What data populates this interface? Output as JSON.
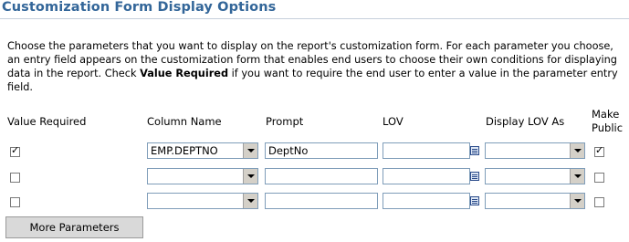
{
  "section": {
    "title": "Customization Form Display Options"
  },
  "description": {
    "part1": "Choose the parameters that you want to display on the report's customization form. For each parameter you choose, an entry field appears on the customization form that enables end users to choose their own conditions for displaying data in the report. Check ",
    "bold": "Value Required",
    "part2": " if you want to require the end user to enter a value in the parameter entry field."
  },
  "headers": {
    "value_required": "Value Required",
    "column_name": "Column Name",
    "prompt": "Prompt",
    "lov": "LOV",
    "display_lov_as": "Display LOV As",
    "make_public_line1": "Make",
    "make_public_line2": "Public"
  },
  "rows": [
    {
      "value_required": true,
      "column_name": "EMP.DEPTNO",
      "prompt": "DeptNo",
      "lov": "",
      "display_lov_as": "",
      "make_public": true
    },
    {
      "value_required": false,
      "column_name": "",
      "prompt": "",
      "lov": "",
      "display_lov_as": "",
      "make_public": false
    },
    {
      "value_required": false,
      "column_name": "",
      "prompt": "",
      "lov": "",
      "display_lov_as": "",
      "make_public": false
    }
  ],
  "buttons": {
    "more_parameters": "More Parameters"
  },
  "icons": {
    "lov_icon": "list-icon",
    "dropdown_icon": "chevron-down-icon",
    "checkbox_icon": "checkmark-icon"
  },
  "colors": {
    "title": "#336699",
    "rule": "#c6d0dc",
    "button_bg": "#d9d9d9"
  }
}
